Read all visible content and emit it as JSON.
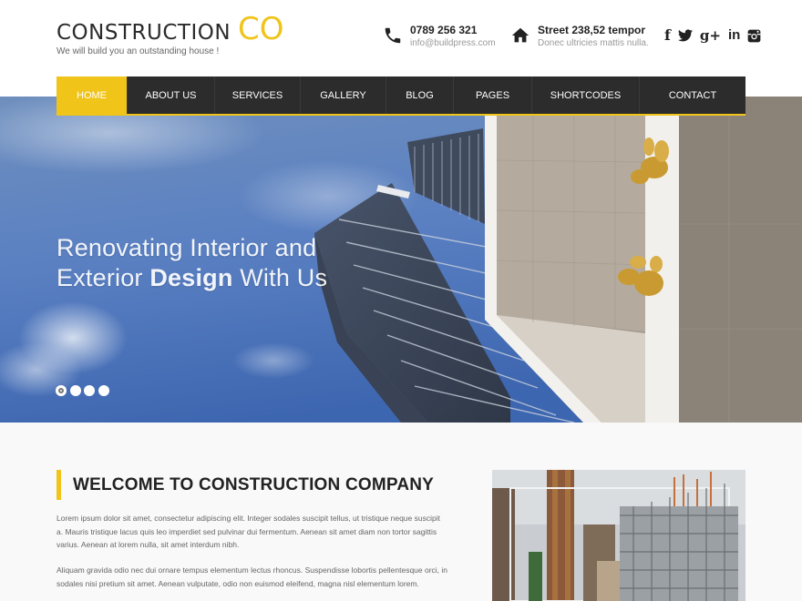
{
  "header": {
    "logo_word": "CONSTRUCTION",
    "logo_co": "CO",
    "tagline": "We will build you an outstanding house !",
    "phone": {
      "icon": "phone-icon",
      "title": "0789 256 321",
      "sub": "info@buildpress.com"
    },
    "address": {
      "icon": "home-icon",
      "title": "Street 238,52 tempor",
      "sub": "Donec ultricies mattis nulla."
    },
    "social": [
      {
        "name": "facebook-icon",
        "glyph": "f"
      },
      {
        "name": "twitter-icon",
        "glyph": "🐦"
      },
      {
        "name": "google-plus-icon",
        "glyph": "g+"
      },
      {
        "name": "linkedin-icon",
        "glyph": "in"
      },
      {
        "name": "instagram-icon",
        "glyph": "◙"
      }
    ]
  },
  "nav": {
    "items": [
      {
        "label": "HOME",
        "active": true
      },
      {
        "label": "ABOUT US"
      },
      {
        "label": "SERVICES"
      },
      {
        "label": "GALLERY"
      },
      {
        "label": "BLOG"
      },
      {
        "label": "PAGES"
      },
      {
        "label": "SHORTCODES"
      },
      {
        "label": "CONTACT"
      }
    ]
  },
  "hero": {
    "line1": "Renovating Interior and",
    "line2_pre": "Exterior ",
    "line2_bold": "Design",
    "line2_post": " With Us",
    "slides": 4,
    "active_slide": 1
  },
  "welcome": {
    "title": "WELCOME TO CONSTRUCTION COMPANY",
    "p1": "Lorem ipsum dolor sit amet, consectetur adipiscing elit. Integer sodales suscipit tellus, ut tristique neque suscipit a. Mauris tristique lacus quis leo imperdiet sed pulvinar dui fermentum. Aenean sit amet diam non tortor sagittis varius. Aenean at lorem nulla, sit amet interdum nibh.",
    "p2": "Aliquam gravida odio nec dui ornare tempus elementum lectus rhoncus. Suspendisse lobortis pellentesque orci, in sodales nisi pretium sit amet. Aenean vulputate, odio non euismod eleifend, magna nisl elementum lorem."
  },
  "colors": {
    "accent": "#f0c419",
    "nav_bg": "#2c2c2c"
  }
}
